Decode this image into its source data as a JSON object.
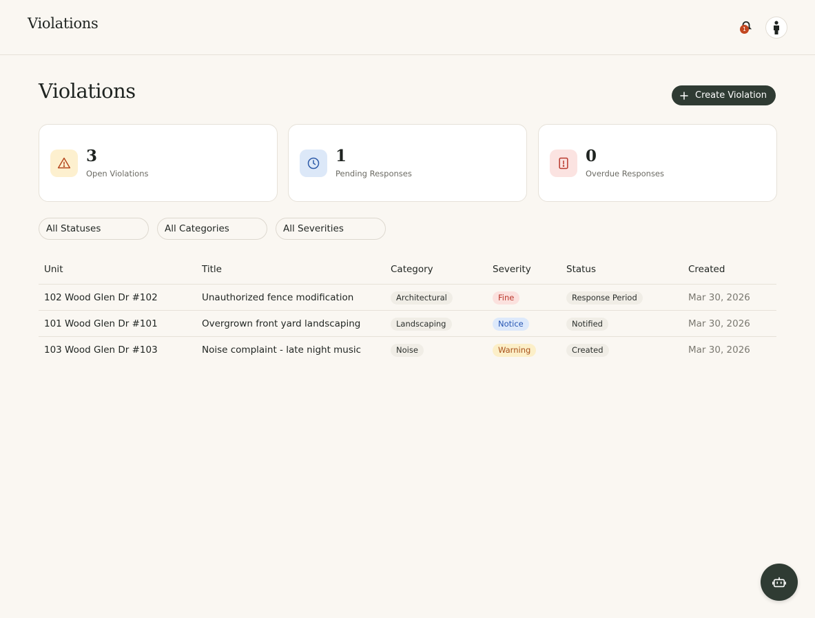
{
  "header": {
    "title": "Violations",
    "notification_count": "1",
    "notification_icon": "bell-icon",
    "avatar_icon": "person-icon"
  },
  "page": {
    "title": "Violations",
    "create_button_label": "Create Violation"
  },
  "stats": [
    {
      "value": "3",
      "label": "Open Violations",
      "icon": "warning-triangle-icon",
      "bg": "#fdf0cf",
      "color": "#b5471e"
    },
    {
      "value": "1",
      "label": "Pending Responses",
      "icon": "clock-icon",
      "bg": "#dce8f8",
      "color": "#2d5aa8"
    },
    {
      "value": "0",
      "label": "Overdue Responses",
      "icon": "alert-octagon-icon",
      "bg": "#fbe3e1",
      "color": "#b9382c"
    }
  ],
  "filters": [
    {
      "label": "All Statuses"
    },
    {
      "label": "All Categories"
    },
    {
      "label": "All Severities"
    }
  ],
  "table": {
    "columns": [
      "Unit",
      "Title",
      "Category",
      "Severity",
      "Status",
      "Created"
    ],
    "rows": [
      {
        "unit": "102 Wood Glen Dr #102",
        "title": "Unauthorized fence modification",
        "category": "Architectural",
        "severity": "Fine",
        "status": "Response Period",
        "created": "Mar 30, 2026"
      },
      {
        "unit": "101 Wood Glen Dr #101",
        "title": "Overgrown front yard landscaping",
        "category": "Landscaping",
        "severity": "Notice",
        "status": "Notified",
        "created": "Mar 30, 2026"
      },
      {
        "unit": "103 Wood Glen Dr #103",
        "title": "Noise complaint - late night music",
        "category": "Noise",
        "severity": "Warning",
        "status": "Created",
        "created": "Mar 30, 2026"
      }
    ]
  },
  "fab": {
    "icon": "robot-icon"
  }
}
